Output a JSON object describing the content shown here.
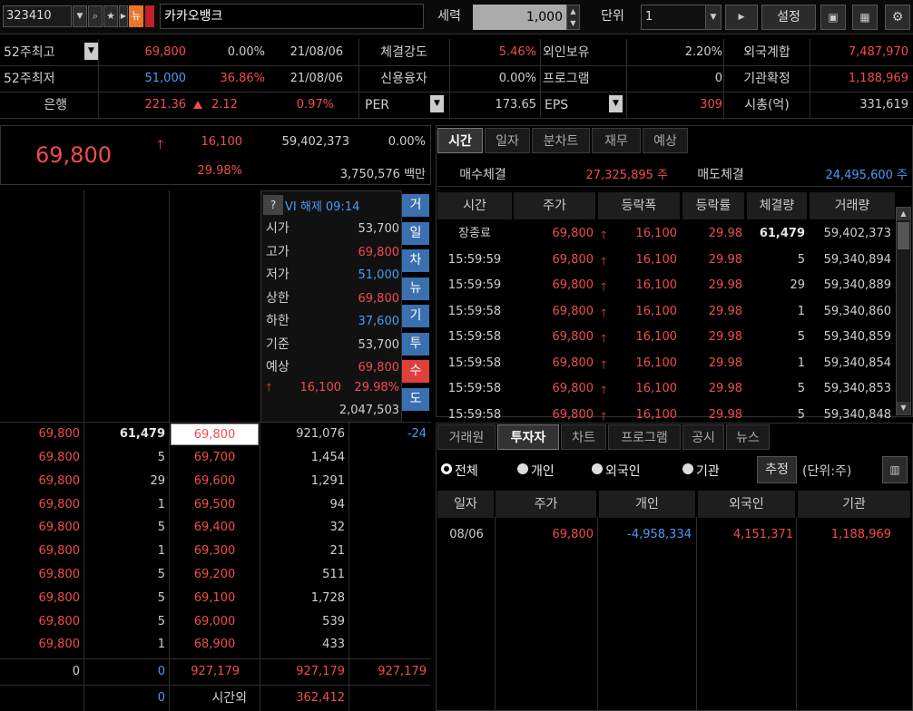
{
  "toolbar": {
    "code": "323410",
    "news_badge": "뉴",
    "name": "카카오뱅크",
    "qty_label": "세력",
    "qty_value": "1,000",
    "unit_label": "단위",
    "unit_value": "1",
    "settings": "설정"
  },
  "info": {
    "r1": [
      "52주최고",
      "69,800",
      "0.00%",
      "21/08/06",
      "체결강도",
      "5.46%",
      "외인보유",
      "2.20%",
      "외국계합",
      "7,487,970"
    ],
    "r2": [
      "52주최저",
      "51,000",
      "36.86%",
      "21/08/06",
      "신용융자",
      "0.00%",
      "프로그램",
      "0",
      "기관확정",
      "1,188,969"
    ],
    "r3": [
      "은행",
      "221.36",
      "2.12",
      "0.97%",
      "PER",
      "173.65",
      "EPS",
      "309",
      "시총(억)",
      "331,619"
    ]
  },
  "price": {
    "current": "69,800",
    "change": "16,100",
    "volume": "59,402,373",
    "rate0": "0.00%",
    "rate": "29.98%",
    "amount": "3,750,576 백만"
  },
  "vi": {
    "label": "VI 해제 09:14",
    "q": "?"
  },
  "ohlc": [
    [
      "시가",
      "53,700"
    ],
    [
      "고가",
      "69,800"
    ],
    [
      "저가",
      "51,000"
    ],
    [
      "상한",
      "69,800"
    ],
    [
      "하한",
      "37,600"
    ],
    [
      "기준",
      "53,700"
    ],
    [
      "예상",
      "69,800"
    ]
  ],
  "expected": {
    "change": "16,100",
    "rate": "29.98%",
    "vol": "2,047,503"
  },
  "side_tabs": [
    "거",
    "일",
    "차",
    "뉴",
    "기",
    "투",
    "수",
    "도"
  ],
  "book_top": {
    "c0": "69,800",
    "c1": "61,479",
    "c2": "69,800",
    "c3": "921,076",
    "c4": "-24"
  },
  "book": [
    [
      "69,800",
      "5",
      "69,700",
      "1,454"
    ],
    [
      "69,800",
      "29",
      "69,600",
      "1,291"
    ],
    [
      "69,800",
      "1",
      "69,500",
      "94"
    ],
    [
      "69,800",
      "5",
      "69,400",
      "32"
    ],
    [
      "69,800",
      "1",
      "69,300",
      "21"
    ],
    [
      "69,800",
      "5",
      "69,200",
      "511"
    ],
    [
      "69,800",
      "5",
      "69,100",
      "1,728"
    ],
    [
      "69,800",
      "5",
      "69,000",
      "539"
    ],
    [
      "69,800",
      "1",
      "68,900",
      "433"
    ]
  ],
  "book_sum": {
    "a": "0",
    "b": "0",
    "c": "927,179",
    "d": "927,179",
    "e": "927,179"
  },
  "book_after": {
    "b": "0",
    "label": "시간외",
    "val": "362,412"
  },
  "tabs1": [
    "시간",
    "일자",
    "분차트",
    "재무",
    "예상"
  ],
  "trade_sum": {
    "buy_label": "매수체결",
    "buy": "27,325,895 주",
    "sell_label": "매도체결",
    "sell": "24,495,600 주"
  },
  "ticks_hdr": [
    "시간",
    "주가",
    "등락폭",
    "등락률",
    "체결량",
    "거래량"
  ],
  "ticks": [
    [
      "장종료",
      "69,800",
      "16,100",
      "29.98",
      "61,479",
      "59,402,373"
    ],
    [
      "15:59:59",
      "69,800",
      "16,100",
      "29.98",
      "5",
      "59,340,894"
    ],
    [
      "15:59:59",
      "69,800",
      "16,100",
      "29.98",
      "29",
      "59,340,889"
    ],
    [
      "15:59:58",
      "69,800",
      "16,100",
      "29.98",
      "1",
      "59,340,860"
    ],
    [
      "15:59:58",
      "69,800",
      "16,100",
      "29.98",
      "5",
      "59,340,859"
    ],
    [
      "15:59:58",
      "69,800",
      "16,100",
      "29.98",
      "1",
      "59,340,854"
    ],
    [
      "15:59:58",
      "69,800",
      "16,100",
      "29.98",
      "5",
      "59,340,853"
    ],
    [
      "15:59:58",
      "69,800",
      "16,100",
      "29.98",
      "5",
      "59,340,848"
    ]
  ],
  "tabs2": [
    "거래원",
    "투자자",
    "차트",
    "프로그램",
    "공시",
    "뉴스"
  ],
  "investor": {
    "opts": [
      "전체",
      "개인",
      "외국인",
      "기관"
    ],
    "est": "추정",
    "unit": "(단위:주)"
  },
  "inv_hdr": [
    "일자",
    "주가",
    "개인",
    "외국인",
    "기관"
  ],
  "inv_row": [
    "08/06",
    "69,800",
    "-4,958,334",
    "4,151,371",
    "1,188,969"
  ]
}
